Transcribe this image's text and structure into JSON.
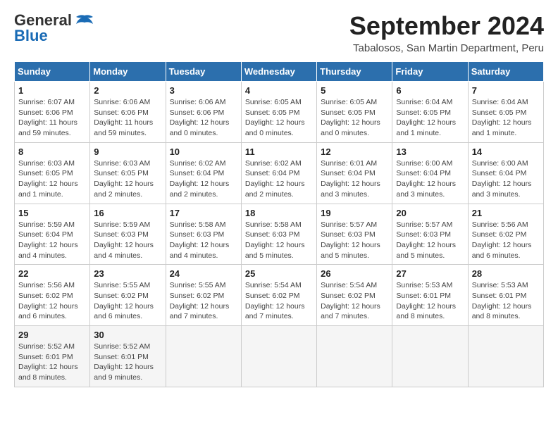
{
  "header": {
    "logo_general": "General",
    "logo_blue": "Blue",
    "month": "September 2024",
    "location": "Tabalosos, San Martin Department, Peru"
  },
  "calendar": {
    "days_of_week": [
      "Sunday",
      "Monday",
      "Tuesday",
      "Wednesday",
      "Thursday",
      "Friday",
      "Saturday"
    ],
    "weeks": [
      [
        {
          "day": "1",
          "info": "Sunrise: 6:07 AM\nSunset: 6:06 PM\nDaylight: 11 hours\nand 59 minutes."
        },
        {
          "day": "2",
          "info": "Sunrise: 6:06 AM\nSunset: 6:06 PM\nDaylight: 11 hours\nand 59 minutes."
        },
        {
          "day": "3",
          "info": "Sunrise: 6:06 AM\nSunset: 6:06 PM\nDaylight: 12 hours\nand 0 minutes."
        },
        {
          "day": "4",
          "info": "Sunrise: 6:05 AM\nSunset: 6:05 PM\nDaylight: 12 hours\nand 0 minutes."
        },
        {
          "day": "5",
          "info": "Sunrise: 6:05 AM\nSunset: 6:05 PM\nDaylight: 12 hours\nand 0 minutes."
        },
        {
          "day": "6",
          "info": "Sunrise: 6:04 AM\nSunset: 6:05 PM\nDaylight: 12 hours\nand 1 minute."
        },
        {
          "day": "7",
          "info": "Sunrise: 6:04 AM\nSunset: 6:05 PM\nDaylight: 12 hours\nand 1 minute."
        }
      ],
      [
        {
          "day": "8",
          "info": "Sunrise: 6:03 AM\nSunset: 6:05 PM\nDaylight: 12 hours\nand 1 minute."
        },
        {
          "day": "9",
          "info": "Sunrise: 6:03 AM\nSunset: 6:05 PM\nDaylight: 12 hours\nand 2 minutes."
        },
        {
          "day": "10",
          "info": "Sunrise: 6:02 AM\nSunset: 6:04 PM\nDaylight: 12 hours\nand 2 minutes."
        },
        {
          "day": "11",
          "info": "Sunrise: 6:02 AM\nSunset: 6:04 PM\nDaylight: 12 hours\nand 2 minutes."
        },
        {
          "day": "12",
          "info": "Sunrise: 6:01 AM\nSunset: 6:04 PM\nDaylight: 12 hours\nand 3 minutes."
        },
        {
          "day": "13",
          "info": "Sunrise: 6:00 AM\nSunset: 6:04 PM\nDaylight: 12 hours\nand 3 minutes."
        },
        {
          "day": "14",
          "info": "Sunrise: 6:00 AM\nSunset: 6:04 PM\nDaylight: 12 hours\nand 3 minutes."
        }
      ],
      [
        {
          "day": "15",
          "info": "Sunrise: 5:59 AM\nSunset: 6:04 PM\nDaylight: 12 hours\nand 4 minutes."
        },
        {
          "day": "16",
          "info": "Sunrise: 5:59 AM\nSunset: 6:03 PM\nDaylight: 12 hours\nand 4 minutes."
        },
        {
          "day": "17",
          "info": "Sunrise: 5:58 AM\nSunset: 6:03 PM\nDaylight: 12 hours\nand 4 minutes."
        },
        {
          "day": "18",
          "info": "Sunrise: 5:58 AM\nSunset: 6:03 PM\nDaylight: 12 hours\nand 5 minutes."
        },
        {
          "day": "19",
          "info": "Sunrise: 5:57 AM\nSunset: 6:03 PM\nDaylight: 12 hours\nand 5 minutes."
        },
        {
          "day": "20",
          "info": "Sunrise: 5:57 AM\nSunset: 6:03 PM\nDaylight: 12 hours\nand 5 minutes."
        },
        {
          "day": "21",
          "info": "Sunrise: 5:56 AM\nSunset: 6:02 PM\nDaylight: 12 hours\nand 6 minutes."
        }
      ],
      [
        {
          "day": "22",
          "info": "Sunrise: 5:56 AM\nSunset: 6:02 PM\nDaylight: 12 hours\nand 6 minutes."
        },
        {
          "day": "23",
          "info": "Sunrise: 5:55 AM\nSunset: 6:02 PM\nDaylight: 12 hours\nand 6 minutes."
        },
        {
          "day": "24",
          "info": "Sunrise: 5:55 AM\nSunset: 6:02 PM\nDaylight: 12 hours\nand 7 minutes."
        },
        {
          "day": "25",
          "info": "Sunrise: 5:54 AM\nSunset: 6:02 PM\nDaylight: 12 hours\nand 7 minutes."
        },
        {
          "day": "26",
          "info": "Sunrise: 5:54 AM\nSunset: 6:02 PM\nDaylight: 12 hours\nand 7 minutes."
        },
        {
          "day": "27",
          "info": "Sunrise: 5:53 AM\nSunset: 6:01 PM\nDaylight: 12 hours\nand 8 minutes."
        },
        {
          "day": "28",
          "info": "Sunrise: 5:53 AM\nSunset: 6:01 PM\nDaylight: 12 hours\nand 8 minutes."
        }
      ],
      [
        {
          "day": "29",
          "info": "Sunrise: 5:52 AM\nSunset: 6:01 PM\nDaylight: 12 hours\nand 8 minutes."
        },
        {
          "day": "30",
          "info": "Sunrise: 5:52 AM\nSunset: 6:01 PM\nDaylight: 12 hours\nand 9 minutes."
        },
        {
          "day": "",
          "info": ""
        },
        {
          "day": "",
          "info": ""
        },
        {
          "day": "",
          "info": ""
        },
        {
          "day": "",
          "info": ""
        },
        {
          "day": "",
          "info": ""
        }
      ]
    ]
  }
}
